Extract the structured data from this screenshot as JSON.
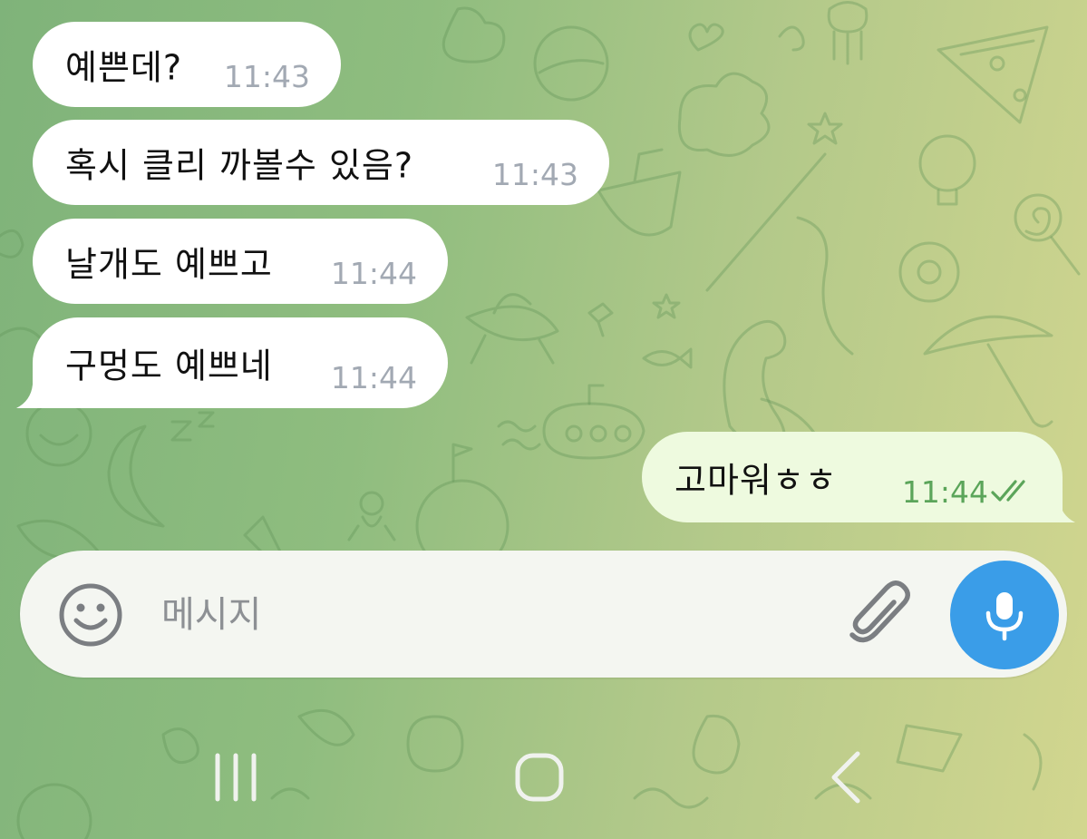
{
  "chat": {
    "incoming": [
      {
        "text": "예쁜데?",
        "time": "11:43"
      },
      {
        "text": "혹시 클리 까볼수 있음?",
        "time": "11:43"
      },
      {
        "text": "날개도 예쁘고",
        "time": "11:44"
      },
      {
        "text": "구멍도 예쁘네",
        "time": "11:44"
      }
    ],
    "outgoing": [
      {
        "text": "고마워ㅎㅎ",
        "time": "11:44",
        "status": "read"
      }
    ]
  },
  "composer": {
    "placeholder": "메시지",
    "value": ""
  },
  "colors": {
    "accent": "#3a9de8",
    "outgoing_bubble": "#eefadf",
    "outgoing_time": "#5ba55a",
    "incoming_bubble": "#ffffff",
    "incoming_time": "#a2a9b3"
  },
  "icons": {
    "emoji": "smile-icon",
    "attach": "paperclip-icon",
    "mic": "microphone-icon",
    "recent_apps": "recent-apps-icon",
    "home": "home-icon",
    "back": "back-icon",
    "read_receipt": "double-check-icon"
  }
}
